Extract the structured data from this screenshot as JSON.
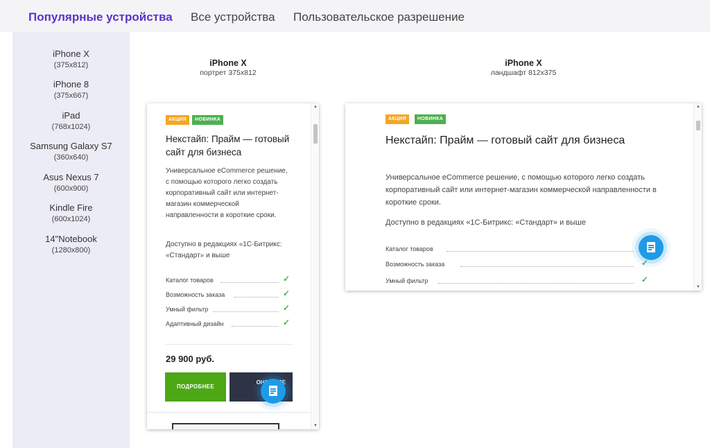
{
  "tabs": [
    {
      "label": "Популярные устройства",
      "active": true
    },
    {
      "label": "Все устройства",
      "active": false
    },
    {
      "label": "Пользовательское разрешение",
      "active": false
    }
  ],
  "devices": [
    {
      "name": "iPhone X",
      "res": "(375x812)"
    },
    {
      "name": "iPhone 8",
      "res": "(375x667)"
    },
    {
      "name": "iPad",
      "res": "(768x1024)"
    },
    {
      "name": "Samsung Galaxy S7",
      "res": "(360x640)"
    },
    {
      "name": "Asus Nexus 7",
      "res": "(600x900)"
    },
    {
      "name": "Kindle Fire",
      "res": "(600x1024)"
    },
    {
      "name": "14\"Notebook",
      "res": "(1280x800)"
    }
  ],
  "previews": {
    "portrait": {
      "title": "iPhone X",
      "sub": "портрет 375x812"
    },
    "landscape": {
      "title": "iPhone X",
      "sub": "ландшафт 812x375"
    }
  },
  "page": {
    "badge_sale": "АКЦИЯ",
    "badge_new": "НОВИНКА",
    "title": "Некстайп: Прайм — готовый сайт для бизнеса",
    "description": "Универсальное eCommerce решение, с помощью которого легко создать корпоративный сайт или интернет-магазин коммерческой направленности в короткие сроки.",
    "editions": "Доступно в редакциях «1С-Битрикс: «Стандарт» и выше",
    "features": [
      "Каталог товаров",
      "Возможность заказа",
      "Умный фильтр",
      "Адаптивный дизайн"
    ],
    "price": "29 900 руб.",
    "more_button": "ПОДРОБНЕЕ",
    "demo_button_partial": "ОНЛАЙ ДЕ"
  },
  "colors": {
    "accent": "#5b34c4",
    "sidebar_bg": "#ececf6",
    "green_button": "#4ca814",
    "dark_button": "#2f3346",
    "chat": "#1e9be8",
    "check": "#4caf50"
  },
  "icons": {
    "chat": "chat-document-icon",
    "check": "check-icon",
    "scroll_up": "triangle-up-icon",
    "scroll_down": "triangle-down-icon"
  }
}
